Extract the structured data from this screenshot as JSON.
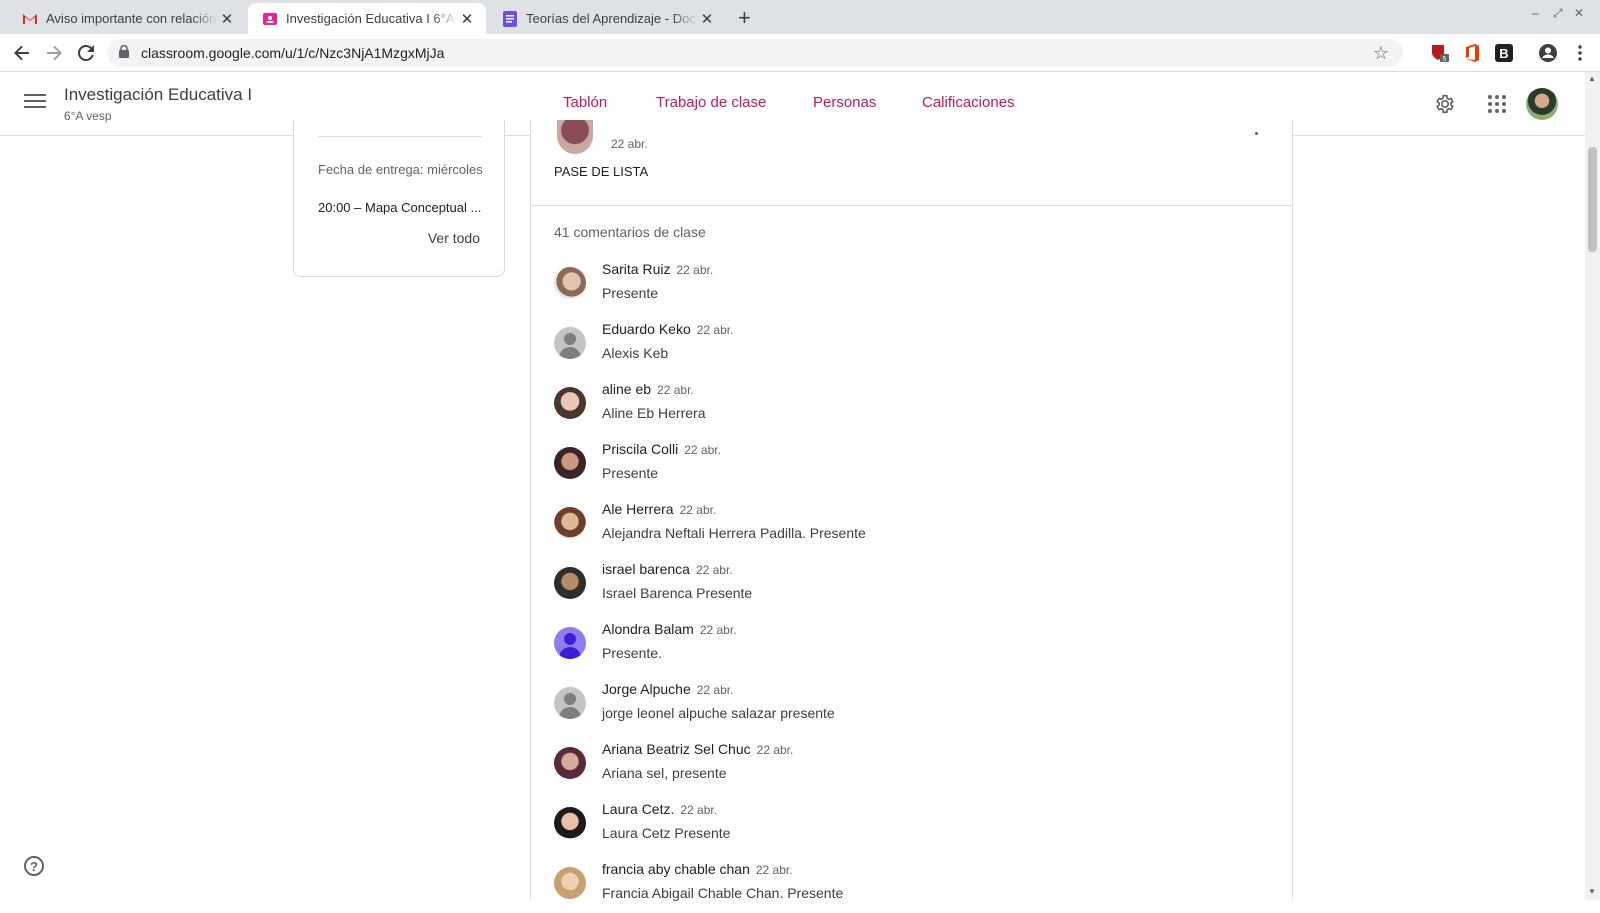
{
  "browser": {
    "tabs": [
      {
        "title": "Aviso importante con relación",
        "favicon": "gmail-icon"
      },
      {
        "title": "Investigación Educativa I 6°A v",
        "favicon": "classroom-icon"
      },
      {
        "title": "Teorías del Aprendizaje - Doc",
        "favicon": "docs-icon"
      }
    ],
    "url": "classroom.google.com/u/1/c/Nzc3NjA1MzgxMjJa",
    "extension_badge": "5",
    "extension_letter": "B"
  },
  "header": {
    "class_title": "Investigación Educativa I",
    "class_subtitle": "6°A vesp",
    "tabs": [
      "Tablón",
      "Trabajo de clase",
      "Personas",
      "Calificaciones"
    ],
    "accent_color": "#c2185b"
  },
  "side_panel": {
    "due_label": "Fecha de entrega: miércoles",
    "due_item": "20:00 – Mapa Conceptual ...",
    "view_all": "Ver todo"
  },
  "post": {
    "date": "22 abr.",
    "text": "PASE DE LISTA",
    "comments_count": "41 comentarios de clase"
  },
  "comments": [
    {
      "name": "Sarita Ruiz",
      "date": "22 abr.",
      "text": "Presente"
    },
    {
      "name": "Eduardo Keko",
      "date": "22 abr.",
      "text": "Alexis Keb"
    },
    {
      "name": "aline eb",
      "date": "22 abr.",
      "text": "Aline Eb Herrera"
    },
    {
      "name": "Priscila Colli",
      "date": "22 abr.",
      "text": "Presente"
    },
    {
      "name": "Ale Herrera",
      "date": "22 abr.",
      "text": "Alejandra Neftali Herrera Padilla. Presente"
    },
    {
      "name": "israel barenca",
      "date": "22 abr.",
      "text": "Israel Barenca Presente"
    },
    {
      "name": "Alondra Balam",
      "date": "22 abr.",
      "text": "Presente."
    },
    {
      "name": "Jorge Alpuche",
      "date": "22 abr.",
      "text": "jorge leonel alpuche salazar presente"
    },
    {
      "name": "Ariana Beatriz Sel Chuc",
      "date": "22 abr.",
      "text": "Ariana sel, presente"
    },
    {
      "name": "Laura Cetz.",
      "date": "22 abr.",
      "text": "Laura Cetz Presente"
    },
    {
      "name": "francia aby chable chan",
      "date": "22 abr.",
      "text": "Francia Abigail Chable Chan. Presente"
    }
  ],
  "help_icon": "?"
}
